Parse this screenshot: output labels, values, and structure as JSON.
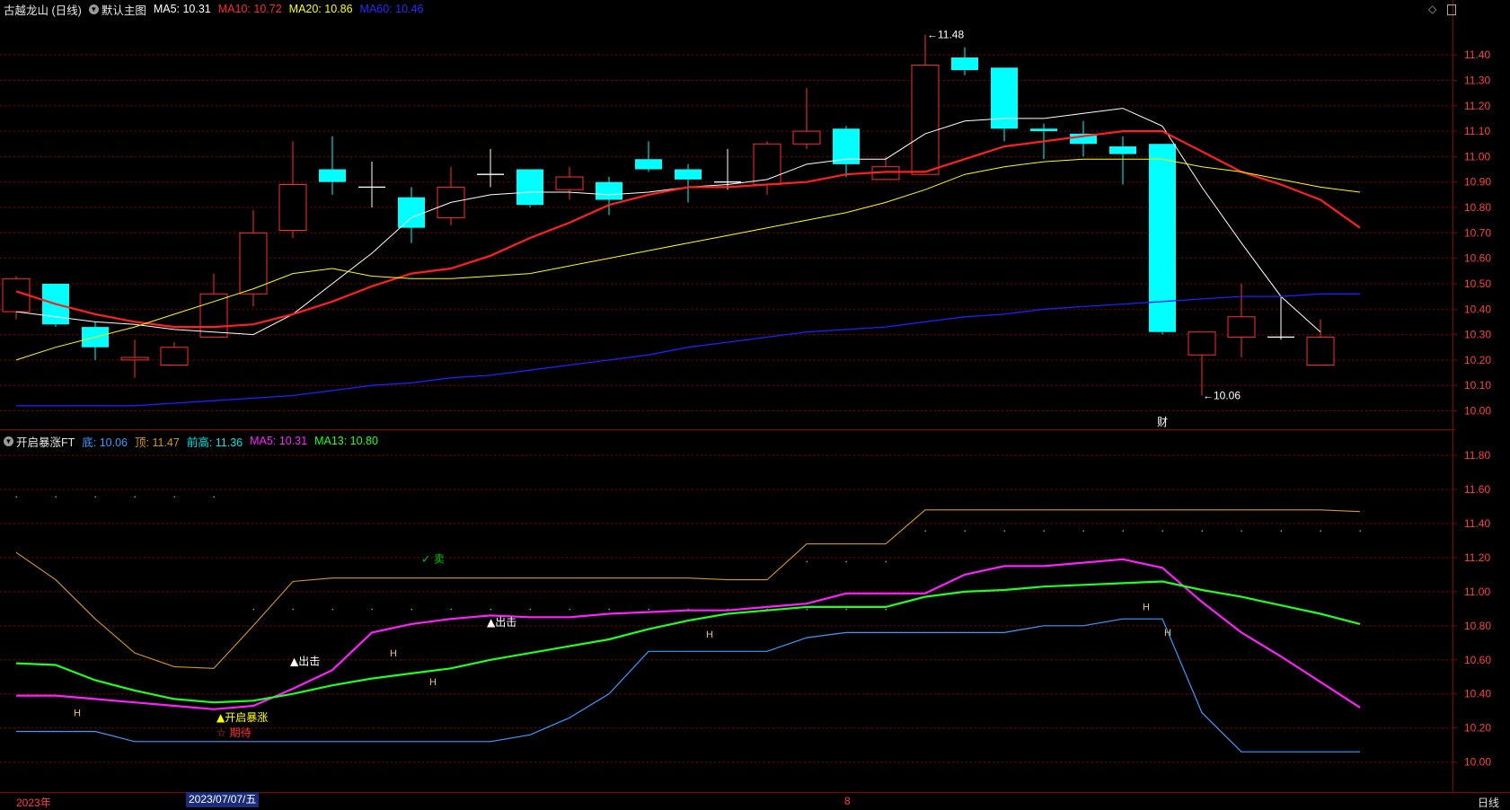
{
  "main_header": {
    "title": "古越龙山 (日线)",
    "template": "默认主图",
    "ma5": "MA5: 10.31",
    "ma10": "MA10: 10.72",
    "ma20": "MA20: 10.86",
    "ma60": "MA60: 10.46"
  },
  "sub_header": {
    "title": "开启暴涨FT",
    "bottom": "底: 10.06",
    "top": "顶: 11.47",
    "prev_high": "前高: 11.36",
    "ma5": "MA5: 10.31",
    "ma13": "MA13: 10.80"
  },
  "bottom_bar": {
    "year_label": "2023年",
    "cursor_date": "2023/07/07/五",
    "month_label": "8",
    "period": "日线"
  },
  "colors": {
    "up": "#ff3030",
    "down": "#00ffff",
    "ma5": "#ffffff",
    "ma10": "#ff2020",
    "ma20": "#ffff00",
    "ma60": "#2020ff",
    "grid": "#8b0000",
    "axis_text": "#ff4040"
  },
  "chart_data": [
    {
      "type": "candlestick",
      "title": "古越龙山 (日线)",
      "y_ticks": [
        "11.40",
        "11.30",
        "11.20",
        "11.10",
        "11.00",
        "10.90",
        "10.80",
        "10.70",
        "10.60",
        "10.50",
        "10.40",
        "10.30",
        "10.20",
        "10.10",
        "10.00"
      ],
      "ylim": [
        9.97,
        11.51
      ],
      "candles": [
        {
          "o": 10.39,
          "h": 10.53,
          "l": 10.36,
          "c": 10.52
        },
        {
          "o": 10.5,
          "h": 10.5,
          "l": 10.33,
          "c": 10.34
        },
        {
          "o": 10.33,
          "h": 10.35,
          "l": 10.2,
          "c": 10.25
        },
        {
          "o": 10.2,
          "h": 10.28,
          "l": 10.13,
          "c": 10.21
        },
        {
          "o": 10.18,
          "h": 10.27,
          "l": 10.18,
          "c": 10.25
        },
        {
          "o": 10.29,
          "h": 10.54,
          "l": 10.29,
          "c": 10.46
        },
        {
          "o": 10.46,
          "h": 10.79,
          "l": 10.41,
          "c": 10.7
        },
        {
          "o": 10.71,
          "h": 11.06,
          "l": 10.68,
          "c": 10.89
        },
        {
          "o": 10.95,
          "h": 11.08,
          "l": 10.85,
          "c": 10.9
        },
        {
          "o": 10.88,
          "h": 10.98,
          "l": 10.8,
          "c": 10.88
        },
        {
          "o": 10.84,
          "h": 10.88,
          "l": 10.66,
          "c": 10.72
        },
        {
          "o": 10.76,
          "h": 10.96,
          "l": 10.73,
          "c": 10.88
        },
        {
          "o": 10.93,
          "h": 11.03,
          "l": 10.88,
          "c": 10.93
        },
        {
          "o": 10.95,
          "h": 10.95,
          "l": 10.8,
          "c": 10.81
        },
        {
          "o": 10.87,
          "h": 10.96,
          "l": 10.83,
          "c": 10.92
        },
        {
          "o": 10.9,
          "h": 10.92,
          "l": 10.77,
          "c": 10.83
        },
        {
          "o": 10.99,
          "h": 11.06,
          "l": 10.94,
          "c": 10.95
        },
        {
          "o": 10.95,
          "h": 10.97,
          "l": 10.82,
          "c": 10.91
        },
        {
          "o": 10.9,
          "h": 11.03,
          "l": 10.87,
          "c": 10.9
        },
        {
          "o": 10.89,
          "h": 11.06,
          "l": 10.85,
          "c": 11.05
        },
        {
          "o": 11.05,
          "h": 11.27,
          "l": 11.03,
          "c": 11.1
        },
        {
          "o": 11.11,
          "h": 11.12,
          "l": 10.92,
          "c": 10.97
        },
        {
          "o": 10.91,
          "h": 11.0,
          "l": 10.91,
          "c": 10.96
        },
        {
          "o": 10.93,
          "h": 11.48,
          "l": 10.93,
          "c": 11.36
        },
        {
          "o": 11.39,
          "h": 11.43,
          "l": 11.32,
          "c": 11.34
        },
        {
          "o": 11.35,
          "h": 11.35,
          "l": 11.06,
          "c": 11.11
        },
        {
          "o": 11.11,
          "h": 11.13,
          "l": 10.99,
          "c": 11.1
        },
        {
          "o": 11.09,
          "h": 11.14,
          "l": 11.0,
          "c": 11.05
        },
        {
          "o": 11.04,
          "h": 11.08,
          "l": 10.89,
          "c": 11.01
        },
        {
          "o": 11.05,
          "h": 11.05,
          "l": 10.3,
          "c": 10.31
        },
        {
          "o": 10.22,
          "h": 10.31,
          "l": 10.06,
          "c": 10.31
        },
        {
          "o": 10.29,
          "h": 10.5,
          "l": 10.21,
          "c": 10.37
        },
        {
          "o": 10.29,
          "h": 10.45,
          "l": 10.28,
          "c": 10.29
        },
        {
          "o": 10.18,
          "h": 10.36,
          "l": 10.18,
          "c": 10.29
        }
      ],
      "series": [
        {
          "name": "MA5",
          "values": [
            10.39,
            10.37,
            10.35,
            10.34,
            10.32,
            10.31,
            10.3,
            10.38,
            10.5,
            10.62,
            10.76,
            10.82,
            10.85,
            10.86,
            10.86,
            10.85,
            10.86,
            10.88,
            10.89,
            10.91,
            10.97,
            10.99,
            10.99,
            11.09,
            11.14,
            11.15,
            11.15,
            11.17,
            11.19,
            11.12,
            10.88,
            10.66,
            10.45,
            10.31
          ]
        },
        {
          "name": "MA10",
          "values": [
            10.47,
            10.42,
            10.38,
            10.35,
            10.33,
            10.33,
            10.34,
            10.38,
            10.43,
            10.49,
            10.54,
            10.56,
            10.61,
            10.68,
            10.74,
            10.81,
            10.85,
            10.88,
            10.88,
            10.89,
            10.9,
            10.93,
            10.94,
            10.94,
            10.99,
            11.04,
            11.06,
            11.08,
            11.1,
            11.1,
            11.02,
            10.94,
            10.89,
            10.83,
            10.72
          ]
        },
        {
          "name": "MA20",
          "values": [
            10.2,
            10.25,
            10.29,
            10.33,
            10.38,
            10.43,
            10.48,
            10.54,
            10.56,
            10.53,
            10.52,
            10.52,
            10.53,
            10.54,
            10.57,
            10.6,
            10.63,
            10.66,
            10.69,
            10.72,
            10.75,
            10.78,
            10.82,
            10.87,
            10.93,
            10.96,
            10.98,
            10.99,
            10.99,
            10.99,
            10.96,
            10.94,
            10.91,
            10.88,
            10.86
          ]
        },
        {
          "name": "MA60",
          "values": [
            10.02,
            10.02,
            10.02,
            10.02,
            10.03,
            10.04,
            10.05,
            10.06,
            10.08,
            10.1,
            10.11,
            10.13,
            10.14,
            10.16,
            10.18,
            10.2,
            10.22,
            10.25,
            10.27,
            10.29,
            10.31,
            10.32,
            10.33,
            10.35,
            10.37,
            10.38,
            10.4,
            10.41,
            10.42,
            10.43,
            10.44,
            10.45,
            10.45,
            10.46,
            10.46
          ]
        }
      ],
      "annotations": [
        {
          "text": "11.48",
          "candle": 23
        },
        {
          "text": "10.06",
          "candle": 30
        },
        {
          "text": "财",
          "candle": 29
        }
      ]
    },
    {
      "type": "line",
      "title": "开启暴涨FT",
      "y_ticks": [
        "11.80",
        "11.60",
        "11.40",
        "11.20",
        "11.00",
        "10.80",
        "10.60",
        "10.40",
        "10.20",
        "10.00"
      ],
      "ylim": [
        9.94,
        11.89
      ],
      "series": [
        {
          "name": "顶",
          "values": [
            11.23,
            11.07,
            10.84,
            10.64,
            10.56,
            10.55,
            10.8,
            11.06,
            11.08,
            11.08,
            11.08,
            11.08,
            11.08,
            11.08,
            11.08,
            11.08,
            11.08,
            11.08,
            11.07,
            11.07,
            11.28,
            11.28,
            11.28,
            11.48,
            11.48,
            11.48,
            11.48,
            11.48,
            11.48,
            11.48,
            11.48,
            11.48,
            11.48,
            11.48,
            11.47
          ]
        },
        {
          "name": "底",
          "values": [
            10.18,
            10.18,
            10.18,
            10.12,
            10.12,
            10.12,
            10.12,
            10.12,
            10.12,
            10.12,
            10.12,
            10.12,
            10.12,
            10.16,
            10.26,
            10.4,
            10.65,
            10.65,
            10.65,
            10.65,
            10.73,
            10.76,
            10.76,
            10.76,
            10.76,
            10.76,
            10.8,
            10.8,
            10.84,
            10.84,
            10.29,
            10.06,
            10.06,
            10.06,
            10.06
          ]
        },
        {
          "name": "MA5",
          "values": [
            10.39,
            10.39,
            10.37,
            10.35,
            10.33,
            10.31,
            10.33,
            10.43,
            10.54,
            10.76,
            10.81,
            10.84,
            10.86,
            10.85,
            10.85,
            10.87,
            10.88,
            10.89,
            10.89,
            10.91,
            10.93,
            10.99,
            10.99,
            10.99,
            11.1,
            11.15,
            11.15,
            11.17,
            11.19,
            11.14,
            10.94,
            10.76,
            10.62,
            10.47,
            10.32
          ]
        },
        {
          "name": "MA13",
          "values": [
            10.58,
            10.57,
            10.48,
            10.42,
            10.37,
            10.35,
            10.36,
            10.4,
            10.45,
            10.49,
            10.52,
            10.55,
            10.6,
            10.64,
            10.68,
            10.72,
            10.78,
            10.83,
            10.87,
            10.89,
            10.91,
            10.91,
            10.91,
            10.97,
            11.0,
            11.01,
            11.03,
            11.04,
            11.05,
            11.06,
            11.01,
            10.97,
            10.92,
            10.87,
            10.81
          ]
        }
      ],
      "signals": [
        {
          "text": "开启暴涨",
          "candle": 5,
          "color": "#ffff00"
        },
        {
          "text": "☆ 期待",
          "candle": 5,
          "color": "#ff3030"
        },
        {
          "text": "▲出击",
          "candle": 7,
          "color": "#ffffff"
        },
        {
          "text": "▲出击",
          "candle": 12,
          "color": "#ffffff"
        },
        {
          "text": "✓ 卖",
          "candle": 10,
          "color": "#00d000"
        }
      ],
      "h_marks": [
        1,
        9,
        10,
        17,
        28,
        29
      ]
    }
  ]
}
